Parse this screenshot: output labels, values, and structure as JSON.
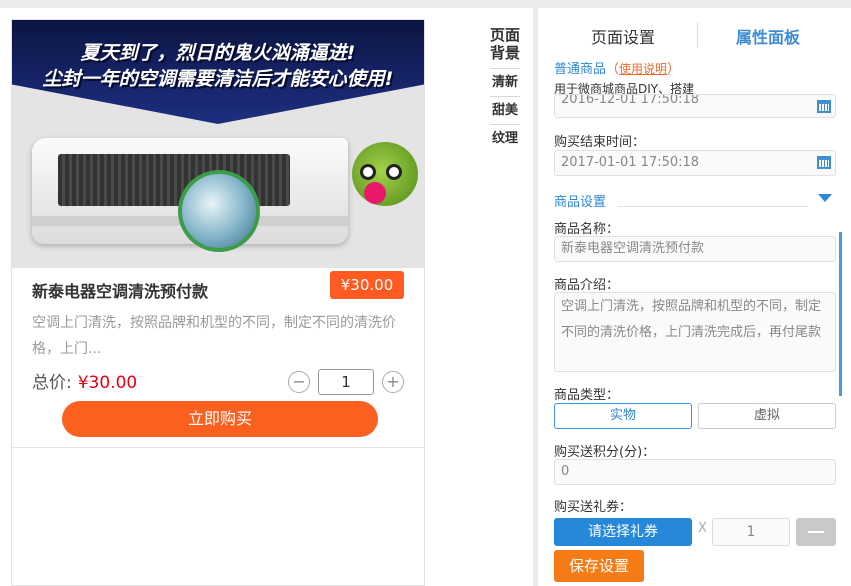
{
  "preview": {
    "banner_line1": "夏天到了，烈日的鬼火汹涌逼进!",
    "banner_line2": "尘封一年的空调需要清洁后才能安心使用!",
    "product_title": "新泰电器空调清洗预付款",
    "price_badge": "¥30.00",
    "desc": "空调上门清洗，按照品牌和机型的不同，制定不同的清洗价格，上门...",
    "total_label": "总价:",
    "total_value": "¥30.00",
    "qty_minus": "−",
    "qty_value": "1",
    "qty_plus": "+",
    "buy_label": "立即购买"
  },
  "side_labels": {
    "bg": "页面背景",
    "fresh": "清新",
    "sweet": "甜美",
    "texture": "纹理"
  },
  "panel": {
    "tabs": [
      "页面设置",
      "属性面板"
    ],
    "active_tab": 1,
    "type_title": "普通商品",
    "help_open": "（",
    "help_link": "使用说明",
    "help_close": "）",
    "type_desc": "用于微商城商品DIY、搭建",
    "start_time": "2016-12-01 17:50:18",
    "end_label": "购买结束时间：",
    "end_time": "2017-01-01 17:50:18",
    "goods_section": "商品设置",
    "name_label": "商品名称：",
    "name_value": "新泰电器空调清洗预付款",
    "intro_label": "商品介绍：",
    "intro_value": "空调上门清洗，按照品牌和机型的不同，制定不同的清洗价格，上门清洗完成后，再付尾款",
    "kind_label": "商品类型：",
    "kind_options": [
      "实物",
      "虚拟"
    ],
    "kind_selected": "实物",
    "points_label": "购买送积分(分)：",
    "points_value": "0",
    "coupon_label": "购买送礼券：",
    "coupon_button": "请选择礼券",
    "coupon_x": "X",
    "coupon_qty": "1",
    "save_label": "保存设置"
  },
  "colors": {
    "accent_blue": "#2f86d6",
    "buy_orange": "#fb601f",
    "save_orange": "#f57b15",
    "price_red": "#e50012"
  },
  "icons": [
    "calendar-icon",
    "chevron-down-icon",
    "minus-icon",
    "plus-icon"
  ]
}
